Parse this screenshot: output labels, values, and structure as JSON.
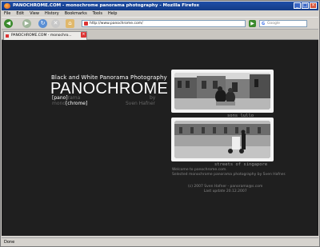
{
  "window": {
    "title": "PANOCHROME.COM - monochrome panorama photography - Mozilla Firefox",
    "controls": [
      "_",
      "□",
      "×"
    ]
  },
  "menu": [
    "File",
    "Edit",
    "View",
    "History",
    "Bookmarks",
    "Tools",
    "Help"
  ],
  "toolbar": {
    "url": "http://www.panochrome.com/",
    "search_placeholder": "Google"
  },
  "tab": {
    "label": "PANOCHROME.COM - monochro..."
  },
  "page": {
    "tagline": "Black and White Panorama Photography",
    "brand": "PANOCHROME",
    "word_line1_a": "[pano]",
    "word_line1_b": "rama",
    "word_line1_c": "by",
    "word_line2_a": "mono",
    "word_line2_b": "[chrome]",
    "word_line2_c": "Sven Hafner",
    "photo1_caption": "sons lullo",
    "photo2_caption": "streets of singapore",
    "welcome_line1": "Welcome to panochrome.com.",
    "welcome_line2": "Selected monochrome panorama photography by Sven Hafner.",
    "footer_line1": "(c) 2007 Sven Hafner - panorama@s.com",
    "footer_line2": "Last update 20.12.2007"
  },
  "status": "Done"
}
